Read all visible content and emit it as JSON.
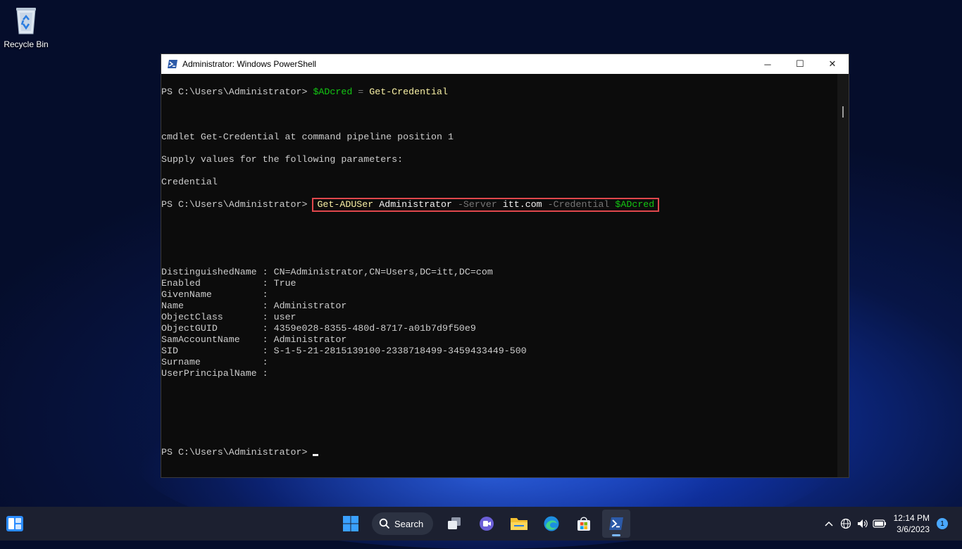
{
  "desktop": {
    "recycle_bin_label": "Recycle Bin"
  },
  "window": {
    "title": "Administrator: Windows PowerShell",
    "minimize": "─",
    "maximize": "☐",
    "close": "✕"
  },
  "console": {
    "prompt": "PS C:\\Users\\Administrator> ",
    "line1_var": "$ADcred",
    "line1_eq": " = ",
    "line1_cmd": "Get-Credential",
    "line3": "cmdlet Get-Credential at command pipeline position 1",
    "line4": "Supply values for the following parameters:",
    "line5": "Credential",
    "cmd2_name": "Get-ADUSer",
    "cmd2_arg": " Administrator ",
    "cmd2_p1": "-Server",
    "cmd2_v1": " itt.com ",
    "cmd2_p2": "-Credential",
    "cmd2_v2": " $ADcred",
    "props": [
      {
        "key": "DistinguishedName",
        "value": "CN=Administrator,CN=Users,DC=itt,DC=com"
      },
      {
        "key": "Enabled          ",
        "value": "True"
      },
      {
        "key": "GivenName        ",
        "value": ""
      },
      {
        "key": "Name             ",
        "value": "Administrator"
      },
      {
        "key": "ObjectClass      ",
        "value": "user"
      },
      {
        "key": "ObjectGUID       ",
        "value": "4359e028-8355-480d-8717-a01b7d9f50e9"
      },
      {
        "key": "SamAccountName   ",
        "value": "Administrator"
      },
      {
        "key": "SID              ",
        "value": "S-1-5-21-2815139100-2338718499-3459433449-500"
      },
      {
        "key": "Surname          ",
        "value": ""
      },
      {
        "key": "UserPrincipalName",
        "value": ""
      }
    ],
    "separator": " : "
  },
  "taskbar": {
    "search_label": "Search",
    "clock_time": "12:14 PM",
    "clock_date": "3/6/2023",
    "notification_count": "1",
    "icons": [
      "start-icon",
      "search-icon",
      "task-view-icon",
      "chat-icon",
      "file-explorer-icon",
      "edge-icon",
      "store-icon",
      "powershell-icon"
    ]
  },
  "colors": {
    "accent": "#4aa8ff",
    "highlight_box": "#e0474c",
    "ps_yellow": "#f9f1a5",
    "ps_green": "#13c613",
    "ps_gray": "#767676"
  }
}
